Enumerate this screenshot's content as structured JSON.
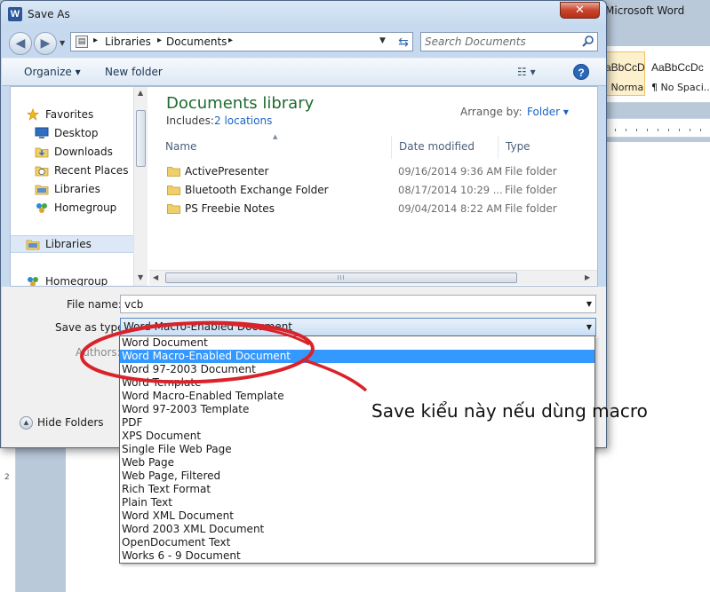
{
  "word": {
    "title": "Microsoft Word",
    "styles": [
      {
        "sample": "AaBbCcDc",
        "name": "¶ Normal"
      },
      {
        "sample": "AaBbCcDc",
        "name": "¶ No Spaci..."
      }
    ],
    "vruler_label": "2"
  },
  "dialog": {
    "title": "Save As",
    "app_icon": "W",
    "close_label": "✕",
    "address": {
      "crumbs": [
        "Libraries",
        "Documents"
      ]
    },
    "search": {
      "placeholder": "Search Documents"
    },
    "toolbar": {
      "organize_label": "Organize ▾",
      "new_folder_label": "New folder",
      "views_label": "☷ ▾",
      "help_label": "?"
    },
    "nav_pane": {
      "items": [
        {
          "label": "Favorites",
          "icon": "star-icon"
        },
        {
          "label": "Desktop",
          "icon": "desktop-icon"
        },
        {
          "label": "Downloads",
          "icon": "downloads-folder-icon"
        },
        {
          "label": "Recent Places",
          "icon": "recent-places-icon"
        },
        {
          "label": "Libraries",
          "icon": "libraries-icon"
        },
        {
          "label": "Homegroup",
          "icon": "homegroup-icon"
        },
        {
          "label": "Libraries",
          "icon": "libraries-icon"
        },
        {
          "label": "Homegroup",
          "icon": "homegroup-icon"
        }
      ]
    },
    "library": {
      "title": "Documents library",
      "includes_label": "Includes:",
      "locations_link": "2 locations",
      "arrange_label": "Arrange by:",
      "arrange_value": "Folder ▾"
    },
    "columns": [
      "Name",
      "Date modified",
      "Type"
    ],
    "files": [
      {
        "name": "ActivePresenter",
        "date": "09/16/2014 9:36 AM",
        "type": "File folder"
      },
      {
        "name": "Bluetooth Exchange Folder",
        "date": "08/17/2014 10:29 ...",
        "type": "File folder"
      },
      {
        "name": "PS Freebie Notes",
        "date": "09/04/2014 8:22 AM",
        "type": "File folder"
      }
    ],
    "form": {
      "file_name_label": "File name:",
      "file_name_value": "vcb",
      "save_type_label": "Save as type:",
      "save_type_value": "Word Macro-Enabled Document",
      "authors_label": "Authors:",
      "hide_folders_label": "Hide Folders"
    },
    "save_type_options": [
      "Word Document",
      "Word Macro-Enabled Document",
      "Word 97-2003 Document",
      "Word Template",
      "Word Macro-Enabled Template",
      "Word 97-2003 Template",
      "PDF",
      "XPS Document",
      "Single File Web Page",
      "Web Page",
      "Web Page, Filtered",
      "Rich Text Format",
      "Plain Text",
      "Word XML Document",
      "Word 2003 XML Document",
      "OpenDocument Text",
      "Works 6 - 9 Document"
    ],
    "selected_option_index": 1
  },
  "annotation": {
    "text": "Save kiểu này nếu dùng macro",
    "color": "#d9232a"
  }
}
